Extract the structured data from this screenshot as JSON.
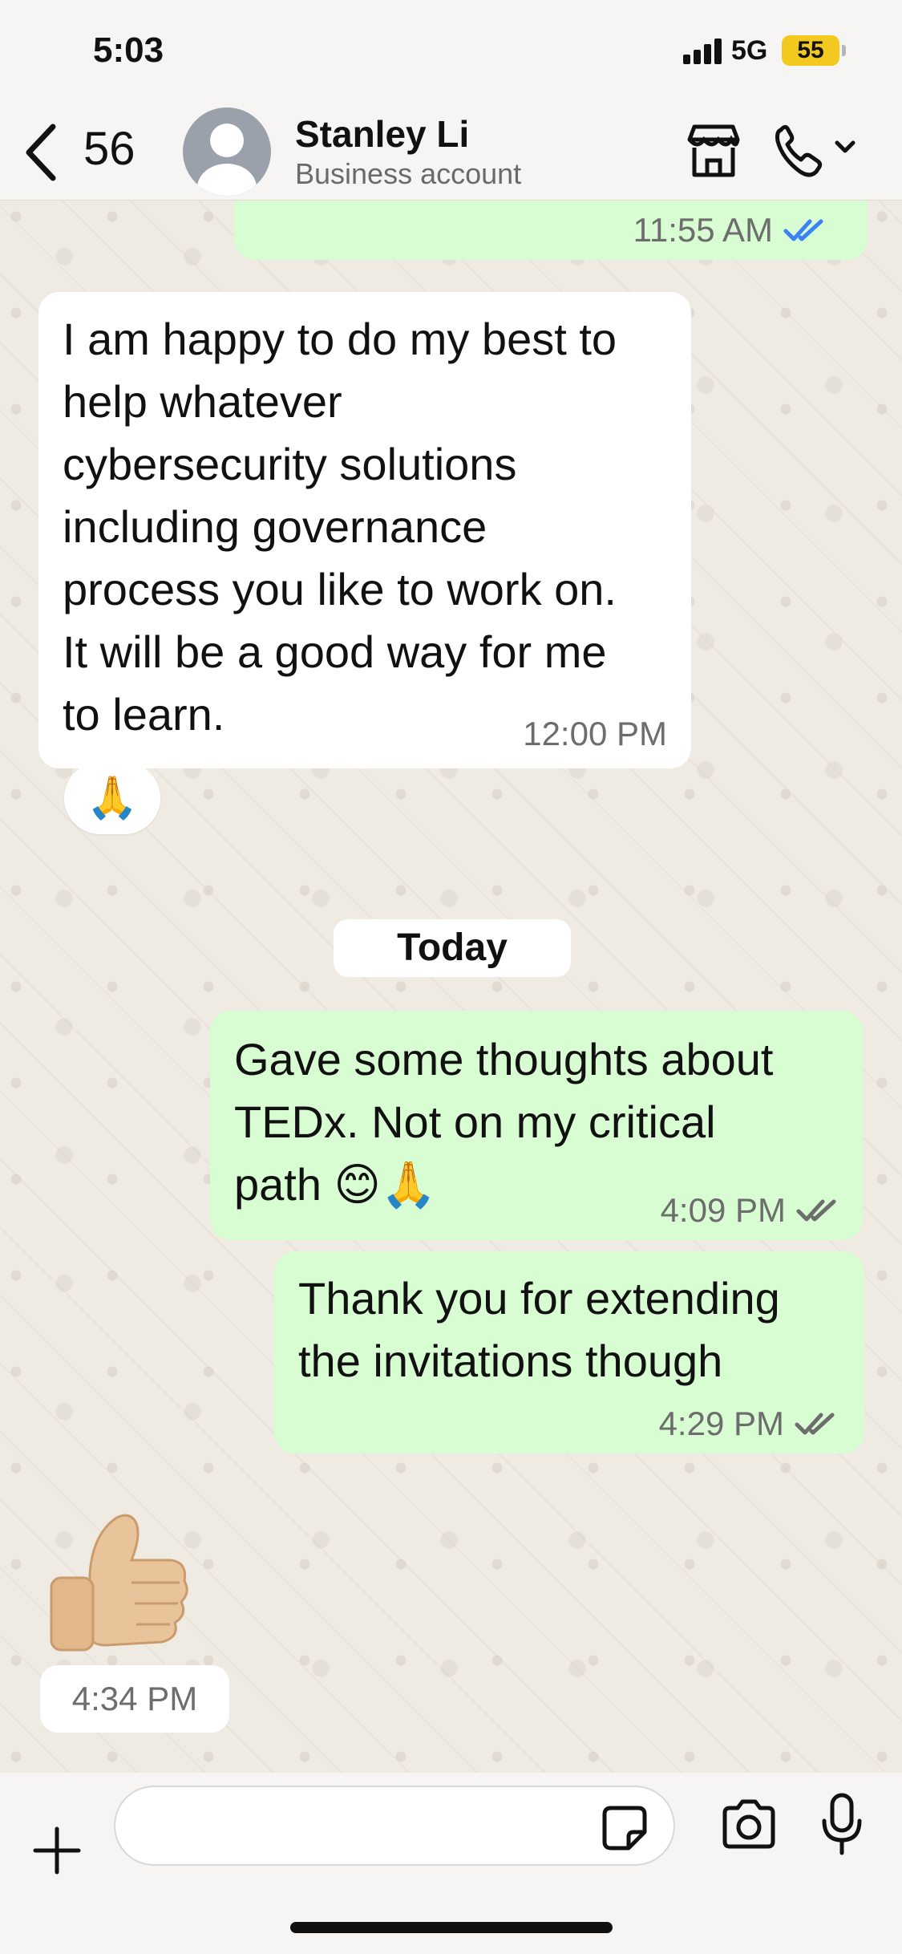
{
  "status_bar": {
    "time": "5:03",
    "network": "5G",
    "battery": "55"
  },
  "header": {
    "back_count": "56",
    "contact_name": "Stanley Li",
    "contact_subtitle": "Business account",
    "icons": [
      "back-icon",
      "store-icon",
      "phone-icon",
      "chevron-down-icon"
    ]
  },
  "messages": [
    {
      "direction": "out",
      "text": "",
      "time": "11:55 AM",
      "status": "read"
    },
    {
      "direction": "in",
      "text": "I am happy to do my best to\nhelp whatever\ncybersecurity solutions\nincluding governance\nprocess you like to work on.\nIt will be a good way for me\nto learn.",
      "time": "12:00 PM",
      "reaction": "🙏"
    },
    {
      "direction": "out",
      "text": "Gave some thoughts about\nTEDx. Not on my critical\npath 😊🙏",
      "time": "4:09 PM",
      "status": "delivered"
    },
    {
      "direction": "out",
      "text": "Thank you for extending\nthe invitations though",
      "time": "4:29 PM",
      "status": "delivered"
    },
    {
      "direction": "in",
      "sticker": "👍",
      "time": "4:34 PM"
    }
  ],
  "date_divider": "Today",
  "input": {
    "value": "",
    "placeholder": ""
  },
  "colors": {
    "outgoing_bubble": "#d9fdd3",
    "incoming_bubble": "#ffffff",
    "read_ticks": "#3b82f6",
    "delivered_ticks": "#6d6d6d",
    "battery": "#f3c81f",
    "wallpaper": "#efeae2"
  }
}
